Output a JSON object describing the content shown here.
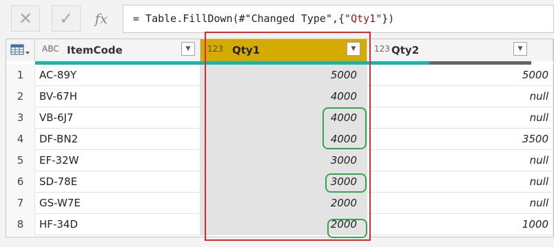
{
  "formula_bar": {
    "cancel_icon": "✕",
    "commit_icon": "✓",
    "fx_label": "fx",
    "formula_prefix": "= Table.FillDown(#\"Changed Type\",{",
    "formula_string": "\"Qty1\"",
    "formula_suffix": "})"
  },
  "columns": [
    {
      "type_icon": "ABC",
      "name": "ItemCode"
    },
    {
      "type_icon": "123",
      "name": "Qty1"
    },
    {
      "type_icon": "123",
      "name": "Qty2"
    }
  ],
  "rows": [
    {
      "n": "1",
      "item": "AC-89Y",
      "qty1": "5000",
      "qty2": "5000"
    },
    {
      "n": "2",
      "item": "BV-67H",
      "qty1": "4000",
      "qty2": "null"
    },
    {
      "n": "3",
      "item": "VB-6J7",
      "qty1": "4000",
      "qty2": "null"
    },
    {
      "n": "4",
      "item": "DF-BN2",
      "qty1": "4000",
      "qty2": "3500"
    },
    {
      "n": "5",
      "item": "EF-32W",
      "qty1": "3000",
      "qty2": "null"
    },
    {
      "n": "6",
      "item": "SD-78E",
      "qty1": "3000",
      "qty2": "null"
    },
    {
      "n": "7",
      "item": "GS-W7E",
      "qty1": "2000",
      "qty2": "null"
    },
    {
      "n": "8",
      "item": "HF-34D",
      "qty1": "2000",
      "qty2": "1000"
    }
  ],
  "colors": {
    "selected_header": "#d6ab00",
    "quality_valid": "#1bb5a8",
    "quality_empty": "#666666",
    "annotation_red": "#d82a2a",
    "annotation_green": "#2ea84a"
  }
}
